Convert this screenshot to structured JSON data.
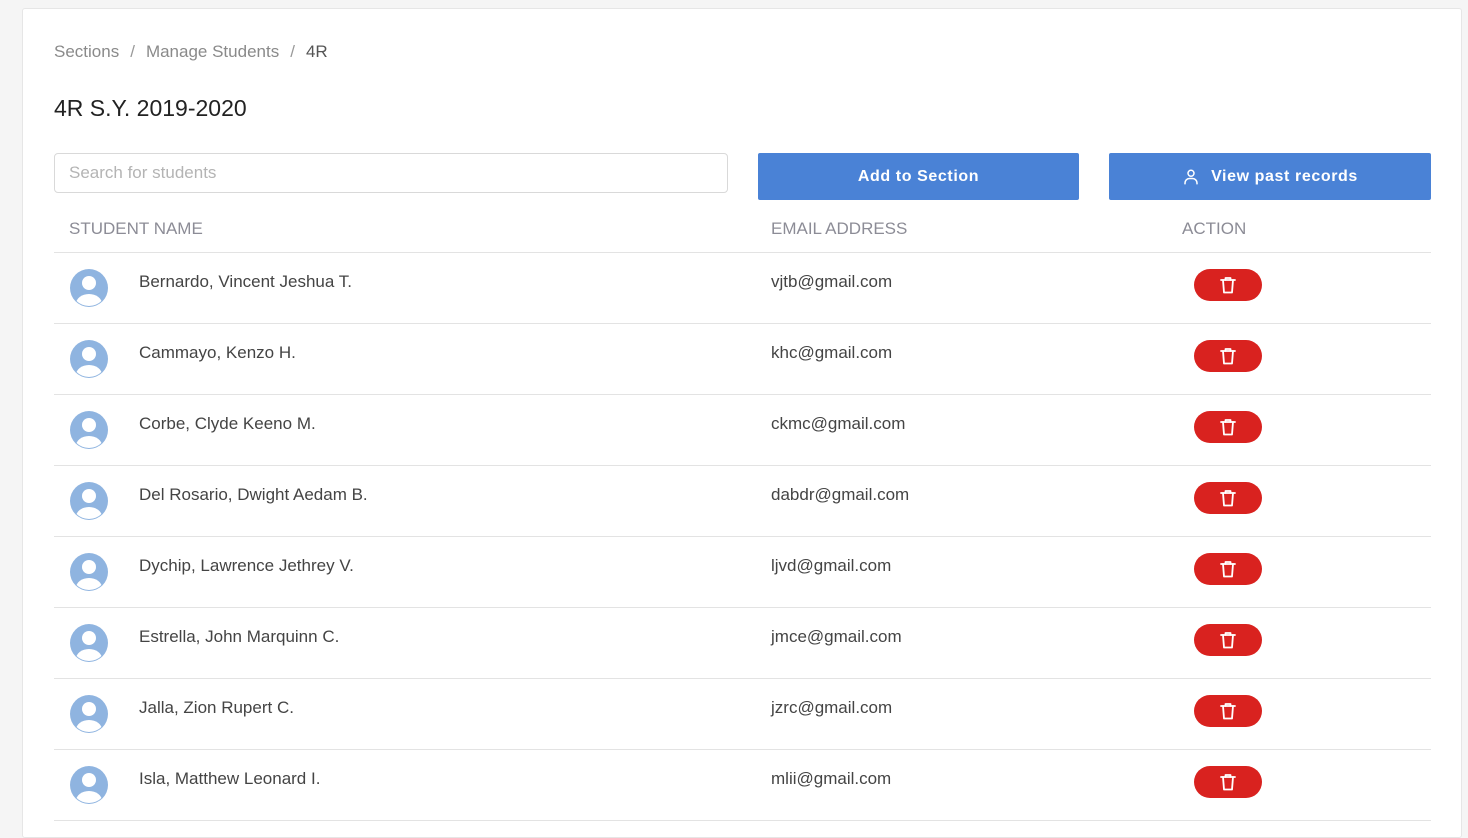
{
  "breadcrumb": {
    "items": [
      "Sections",
      "Manage Students",
      "4R"
    ],
    "separator": "/"
  },
  "page_title": "4R S.Y. 2019-2020",
  "search": {
    "placeholder": "Search for students",
    "value": ""
  },
  "buttons": {
    "add_to_section": "Add to Section",
    "view_past_records": "View past records",
    "view_past_records_icon": "user-icon"
  },
  "table": {
    "headers": {
      "name": "STUDENT NAME",
      "email": "EMAIL ADDRESS",
      "action": "ACTION"
    },
    "rows": [
      {
        "name": "Bernardo, Vincent Jeshua T.",
        "email": "vjtb@gmail.com"
      },
      {
        "name": "Cammayo, Kenzo H.",
        "email": "khc@gmail.com"
      },
      {
        "name": "Corbe, Clyde Keeno M.",
        "email": "ckmc@gmail.com"
      },
      {
        "name": "Del Rosario, Dwight Aedam B.",
        "email": "dabdr@gmail.com"
      },
      {
        "name": "Dychip, Lawrence Jethrey V.",
        "email": "ljvd@gmail.com"
      },
      {
        "name": "Estrella, John Marquinn C.",
        "email": "jmce@gmail.com"
      },
      {
        "name": "Jalla, Zion Rupert C.",
        "email": "jzrc@gmail.com"
      },
      {
        "name": "Isla, Matthew Leonard I.",
        "email": "mlii@gmail.com"
      }
    ],
    "row_icons": {
      "avatar": "avatar-icon",
      "delete": "trash-icon"
    }
  },
  "colors": {
    "primary": "#4a82d6",
    "danger": "#d9221f",
    "avatar": "#8fb4e0"
  }
}
